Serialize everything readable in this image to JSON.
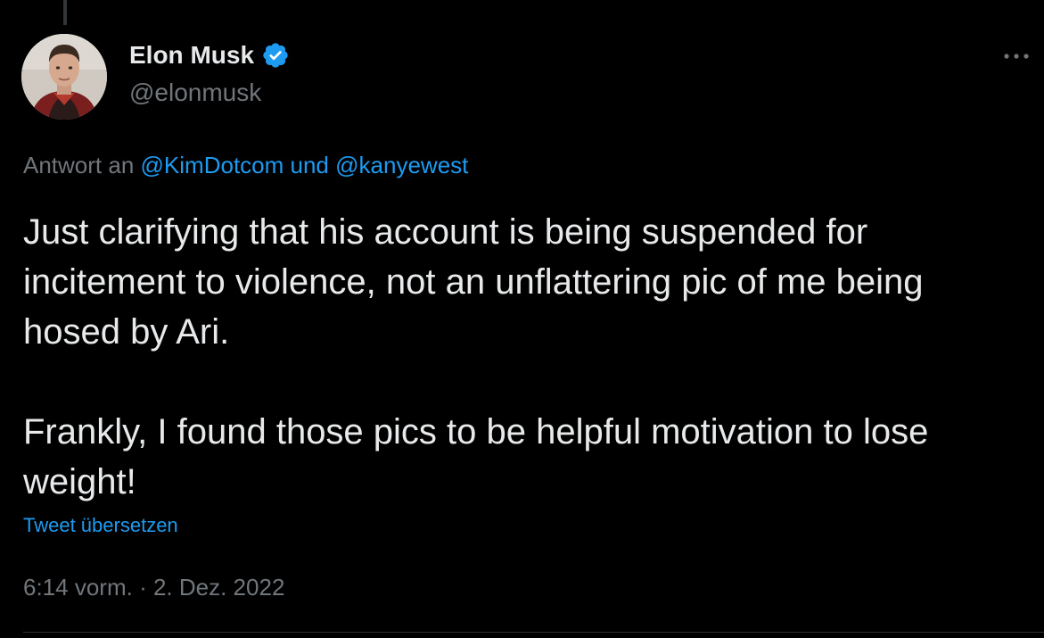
{
  "tweet": {
    "author": {
      "name": "Elon Musk",
      "handle": "@elonmusk",
      "verified": true
    },
    "reply_context": {
      "prefix": "Antwort an",
      "mention_1": "@KimDotcom",
      "conjunction": "und",
      "mention_2": "@kanyewest"
    },
    "paragraphs": [
      "Just clarifying that his account is being suspended for incitement to violence, not an unflattering pic of me being hosed by Ari.",
      "Frankly, I found those pics to be helpful motivation to lose weight!"
    ],
    "translate_label": "Tweet übersetzen",
    "time": "6:14 vorm.",
    "separator": "·",
    "date": "2. Dez. 2022"
  },
  "icons": {
    "verified": "verified-badge-icon",
    "more": "more-options-icon"
  },
  "colors": {
    "background": "#000000",
    "text_primary": "#e7e9ea",
    "text_secondary": "#71767b",
    "accent": "#1d9bf0"
  }
}
